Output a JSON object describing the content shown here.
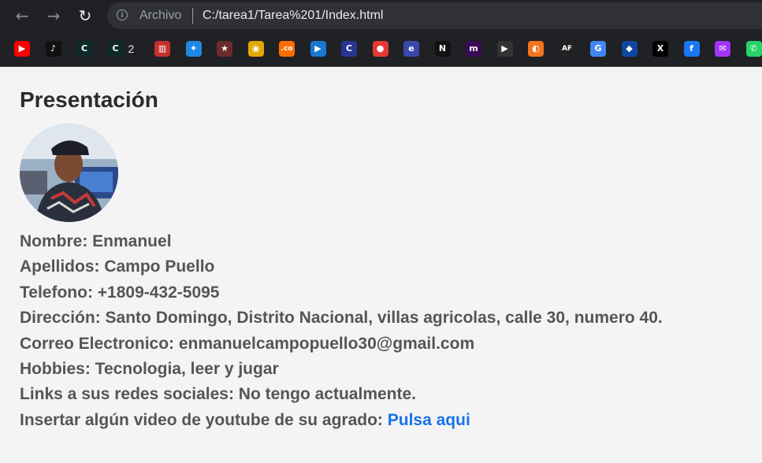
{
  "browser": {
    "chip": "Archivo",
    "url": "C:/tarea1/Tarea%201/Index.html",
    "bookmarks": [
      {
        "icon": "youtube-icon",
        "color": "#ff0000",
        "glyph": "▶"
      },
      {
        "icon": "tiktok-icon",
        "color": "#111111",
        "glyph": "♪"
      },
      {
        "icon": "c-icon",
        "color": "#0d2b2b",
        "glyph": "C"
      },
      {
        "icon": "c-icon",
        "color": "#0d2b2b",
        "glyph": "C",
        "label": "2"
      },
      {
        "icon": "popcorn-icon",
        "color": "#c4302b",
        "glyph": "▥"
      },
      {
        "icon": "puzzle-icon",
        "color": "#1e88e5",
        "glyph": "✦"
      },
      {
        "icon": "anime-icon",
        "color": "#6d2c2c",
        "glyph": "★"
      },
      {
        "icon": "play-circle-icon",
        "color": "#e0a800",
        "glyph": "◉"
      },
      {
        "icon": "co-icon",
        "color": "#ff6f00",
        "glyph": ".co"
      },
      {
        "icon": "play-blue-icon",
        "color": "#1976d2",
        "glyph": "▶"
      },
      {
        "icon": "c-blue-icon",
        "color": "#283593",
        "glyph": "C"
      },
      {
        "icon": "claro-icon",
        "color": "#e53935",
        "glyph": "●"
      },
      {
        "icon": "e-icon",
        "color": "#3949ab",
        "glyph": "e"
      },
      {
        "icon": "netflix-icon",
        "color": "#111111",
        "glyph": "N"
      },
      {
        "icon": "m-icon",
        "color": "#3b0a57",
        "glyph": "m"
      },
      {
        "icon": "film-icon",
        "color": "#333333",
        "glyph": "▶"
      },
      {
        "icon": "crunchyroll-icon",
        "color": "#f47521",
        "glyph": "◐"
      },
      {
        "icon": "af-icon",
        "color": "#222222",
        "glyph": "AF"
      },
      {
        "icon": "translate-icon",
        "color": "#4285f4",
        "glyph": "G"
      },
      {
        "icon": "shield-icon",
        "color": "#0d47a1",
        "glyph": "◆"
      },
      {
        "icon": "x-icon",
        "color": "#000000",
        "glyph": "X"
      },
      {
        "icon": "facebook-icon",
        "color": "#1877f2",
        "glyph": "f"
      },
      {
        "icon": "messenger-icon",
        "color": "#a334fa",
        "glyph": "✉"
      },
      {
        "icon": "whatsapp-icon",
        "color": "#25d366",
        "glyph": "✆"
      }
    ]
  },
  "page": {
    "title": "Presentación",
    "lines": [
      "Nombre: Enmanuel",
      "Apellidos: Campo Puello",
      "Telefono: +1809-432-5095",
      "Dirección: Santo Domingo, Distrito Nacional, villas agricolas, calle 30, numero 40.",
      "Correo Electronico: enmanuelcampopuello30@gmail.com",
      "Hobbies: Tecnologia, leer y jugar",
      "Links a sus redes sociales: No tengo actualmente."
    ],
    "video_prefix": "Insertar algún video de youtube de su agrado: ",
    "video_link": "Pulsa aqui"
  },
  "colors": {
    "link": "#1a73e8",
    "text": "#555555",
    "title": "#2b2b2b"
  }
}
